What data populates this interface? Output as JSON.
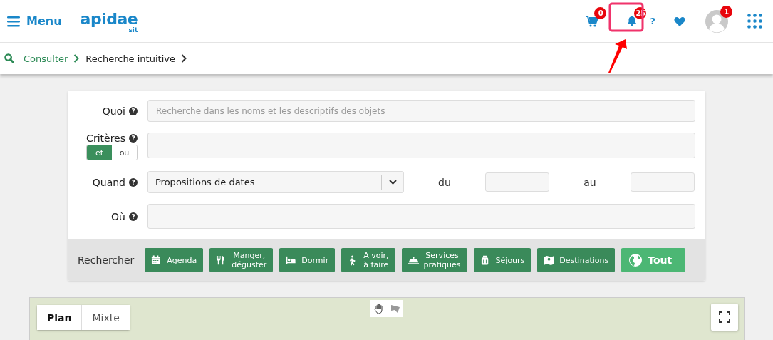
{
  "header": {
    "menu_label": "Menu",
    "logo": "apidae",
    "logo_sub": "sit",
    "cart_count": "0",
    "notification_count": "25",
    "help": "?",
    "avatar_count": "1",
    "highlight": true
  },
  "breadcrumb": [
    {
      "label": "Consulter",
      "link": true
    },
    {
      "label": "Recherche intuitive",
      "link": false
    }
  ],
  "form": {
    "quoi": {
      "label": "Quoi",
      "help": "?",
      "placeholder": "Recherche dans les noms et les descriptifs des objets"
    },
    "criteres": {
      "label": "Critères",
      "help": "?",
      "toggle": [
        {
          "label": "et",
          "selected": true
        },
        {
          "label": "ou",
          "selected": false
        }
      ]
    },
    "quand": {
      "label": "Quand",
      "help": "?",
      "value": "Propositions de dates",
      "from_label": "du",
      "to_label": "au"
    },
    "ou": {
      "label": "Où",
      "help": "?"
    },
    "search_label": "Rechercher",
    "buttons": [
      {
        "label": "Agenda",
        "kind": "category"
      },
      {
        "label": "Manger,\ndéguster",
        "kind": "category"
      },
      {
        "label": "Dormir",
        "kind": "category"
      },
      {
        "label": "A voir,\nà faire",
        "kind": "category"
      },
      {
        "label": "Services\npratiques",
        "kind": "category"
      },
      {
        "label": "Séjours",
        "kind": "category"
      },
      {
        "label": "Destinations",
        "kind": "category"
      },
      {
        "label": "Tout",
        "kind": "primary"
      }
    ]
  },
  "map": {
    "tabs": [
      {
        "label": "Plan",
        "selected": true
      },
      {
        "label": "Mixte",
        "selected": false
      }
    ]
  }
}
